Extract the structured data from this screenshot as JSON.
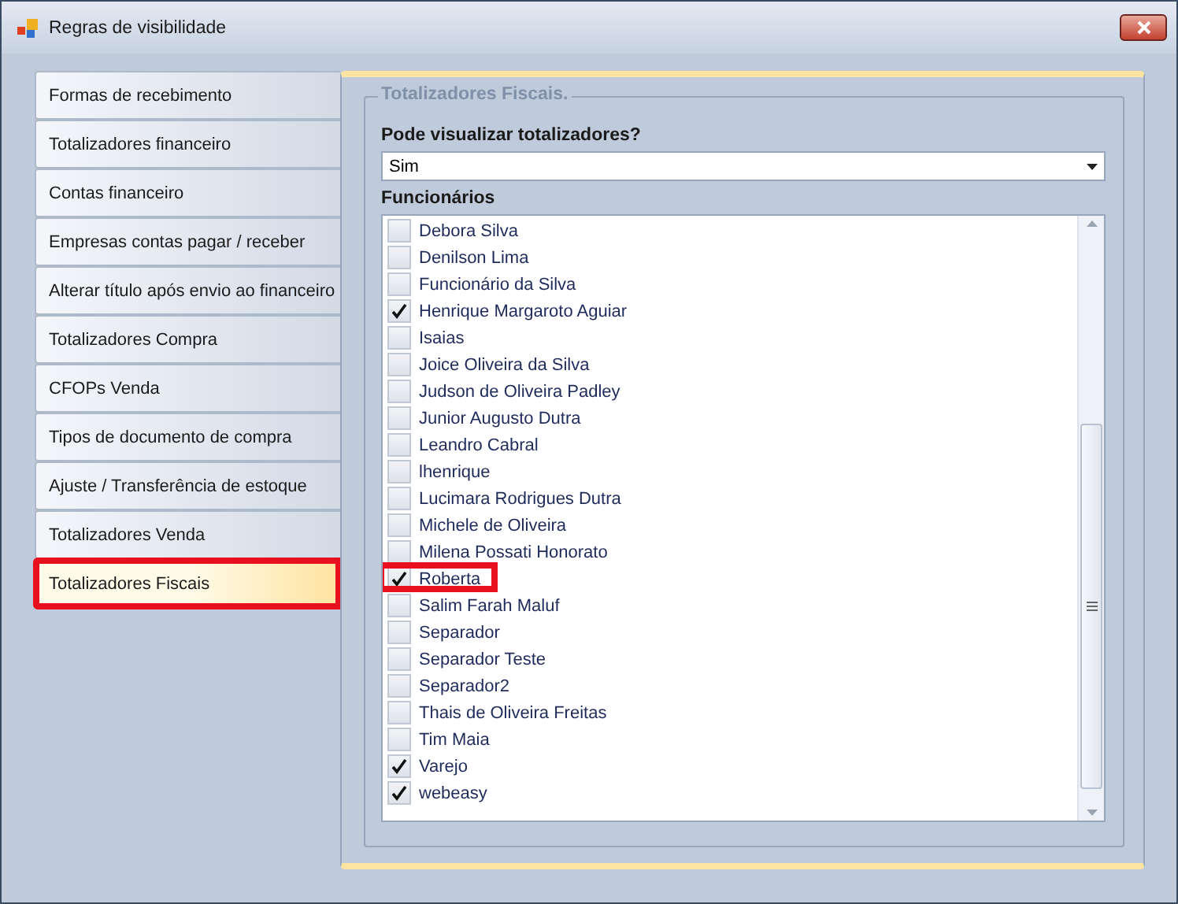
{
  "window": {
    "title": "Regras de visibilidade"
  },
  "tabs": [
    {
      "label": "Formas de recebimento",
      "selected": false,
      "highlighted": false
    },
    {
      "label": "Totalizadores financeiro",
      "selected": false,
      "highlighted": false
    },
    {
      "label": "Contas financeiro",
      "selected": false,
      "highlighted": false
    },
    {
      "label": "Empresas contas pagar / receber",
      "selected": false,
      "highlighted": false
    },
    {
      "label": "Alterar título após envio ao financeiro",
      "selected": false,
      "highlighted": false
    },
    {
      "label": "Totalizadores Compra",
      "selected": false,
      "highlighted": false
    },
    {
      "label": "CFOPs Venda",
      "selected": false,
      "highlighted": false
    },
    {
      "label": "Tipos de documento de compra",
      "selected": false,
      "highlighted": false
    },
    {
      "label": "Ajuste / Transferência de estoque",
      "selected": false,
      "highlighted": false
    },
    {
      "label": "Totalizadores Venda",
      "selected": false,
      "highlighted": false
    },
    {
      "label": "Totalizadores Fiscais",
      "selected": true,
      "highlighted": true
    }
  ],
  "group": {
    "title": "Totalizadores Fiscais.",
    "question": "Pode visualizar totalizadores?",
    "select_value": "Sim",
    "list_label": "Funcionários",
    "employees": [
      {
        "name": "Debora Silva",
        "checked": false,
        "highlighted": false
      },
      {
        "name": "Denilson Lima",
        "checked": false,
        "highlighted": false
      },
      {
        "name": "Funcionário da Silva",
        "checked": false,
        "highlighted": false
      },
      {
        "name": "Henrique Margaroto Aguiar",
        "checked": true,
        "highlighted": false
      },
      {
        "name": "Isaias",
        "checked": false,
        "highlighted": false
      },
      {
        "name": "Joice Oliveira da Silva",
        "checked": false,
        "highlighted": false
      },
      {
        "name": "Judson de Oliveira Padley",
        "checked": false,
        "highlighted": false
      },
      {
        "name": "Junior Augusto Dutra",
        "checked": false,
        "highlighted": false
      },
      {
        "name": "Leandro Cabral",
        "checked": false,
        "highlighted": false
      },
      {
        "name": "lhenrique",
        "checked": false,
        "highlighted": false
      },
      {
        "name": "Lucimara Rodrigues Dutra",
        "checked": false,
        "highlighted": false
      },
      {
        "name": "Michele de Oliveira",
        "checked": false,
        "highlighted": false
      },
      {
        "name": "Milena Possati Honorato",
        "checked": false,
        "highlighted": false
      },
      {
        "name": "Roberta",
        "checked": true,
        "highlighted": true
      },
      {
        "name": "Salim Farah Maluf",
        "checked": false,
        "highlighted": false
      },
      {
        "name": "Separador",
        "checked": false,
        "highlighted": false
      },
      {
        "name": "Separador Teste",
        "checked": false,
        "highlighted": false
      },
      {
        "name": "Separador2",
        "checked": false,
        "highlighted": false
      },
      {
        "name": "Thais de Oliveira Freitas",
        "checked": false,
        "highlighted": false
      },
      {
        "name": "Tim Maia",
        "checked": false,
        "highlighted": false
      },
      {
        "name": "Varejo",
        "checked": true,
        "highlighted": false
      },
      {
        "name": "webeasy",
        "checked": true,
        "highlighted": false
      }
    ]
  }
}
